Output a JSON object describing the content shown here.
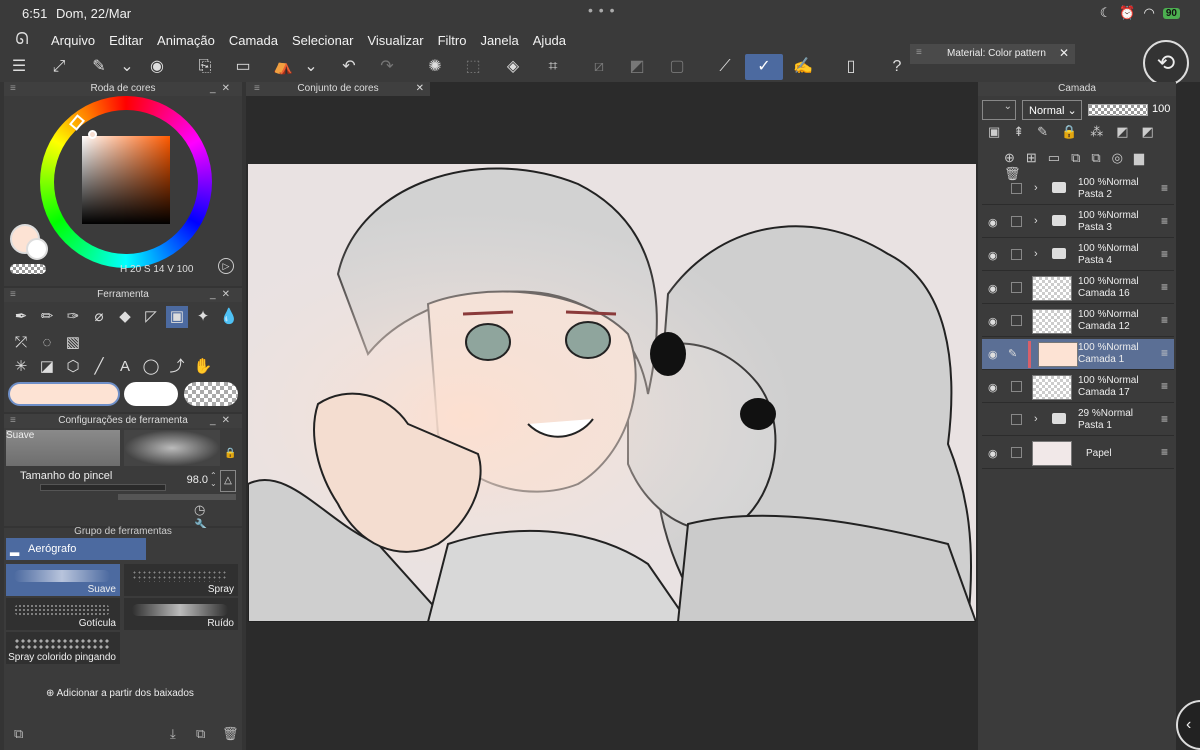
{
  "status": {
    "time": "6:51",
    "date": "Dom, 22/Mar",
    "battery": "90"
  },
  "menu": [
    "Arquivo",
    "Editar",
    "Animação",
    "Camada",
    "Selecionar",
    "Visualizar",
    "Filtro",
    "Janela",
    "Ajuda"
  ],
  "material_panel": {
    "title": "Material: Color pattern"
  },
  "color_wheel": {
    "title": "Roda de cores",
    "main_color": "#fde3d4",
    "readout": {
      "h": "20",
      "s": "14",
      "v": "100",
      "h_label": "H",
      "s_label": "S",
      "v_label": "V"
    }
  },
  "color_set": {
    "title": "Conjunto de cores"
  },
  "tool_panel": {
    "title": "Ferramenta"
  },
  "tool_settings": {
    "title": "Configurações de ferramenta",
    "preview_label": "Suave",
    "size_label": "Tamanho do pincel",
    "size_value": "98.0"
  },
  "subtool": {
    "title": "Grupo de ferramentas",
    "group": "Aerógrafo",
    "brushes": [
      "Suave",
      "Spray",
      "Gotícula",
      "Ruído",
      "Spray colorido pingando"
    ],
    "add_label": "Adicionar a partir dos baixados"
  },
  "layers": {
    "title": "Camada",
    "blend_mode": "Normal",
    "opacity": "100",
    "items": [
      {
        "l1": "100 %Normal",
        "l2": "Pasta 2",
        "kind": "folder",
        "visible": false
      },
      {
        "l1": "100 %Normal",
        "l2": "Pasta 3",
        "kind": "folder",
        "visible": true
      },
      {
        "l1": "100 %Normal",
        "l2": "Pasta 4",
        "kind": "folder",
        "visible": true
      },
      {
        "l1": "100 %Normal",
        "l2": "Camada 16",
        "kind": "layer",
        "visible": true
      },
      {
        "l1": "100 %Normal",
        "l2": "Camada 12",
        "kind": "layer",
        "visible": true
      },
      {
        "l1": "100 %Normal",
        "l2": "Camada 1",
        "kind": "layer",
        "visible": true,
        "selected": true
      },
      {
        "l1": "100 %Normal",
        "l2": "Camada 17",
        "kind": "layer",
        "visible": true
      },
      {
        "l1": "29 %Normal",
        "l2": "Pasta 1",
        "kind": "folder",
        "visible": false
      },
      {
        "l1": "",
        "l2": "Papel",
        "kind": "paper",
        "visible": true
      }
    ]
  }
}
